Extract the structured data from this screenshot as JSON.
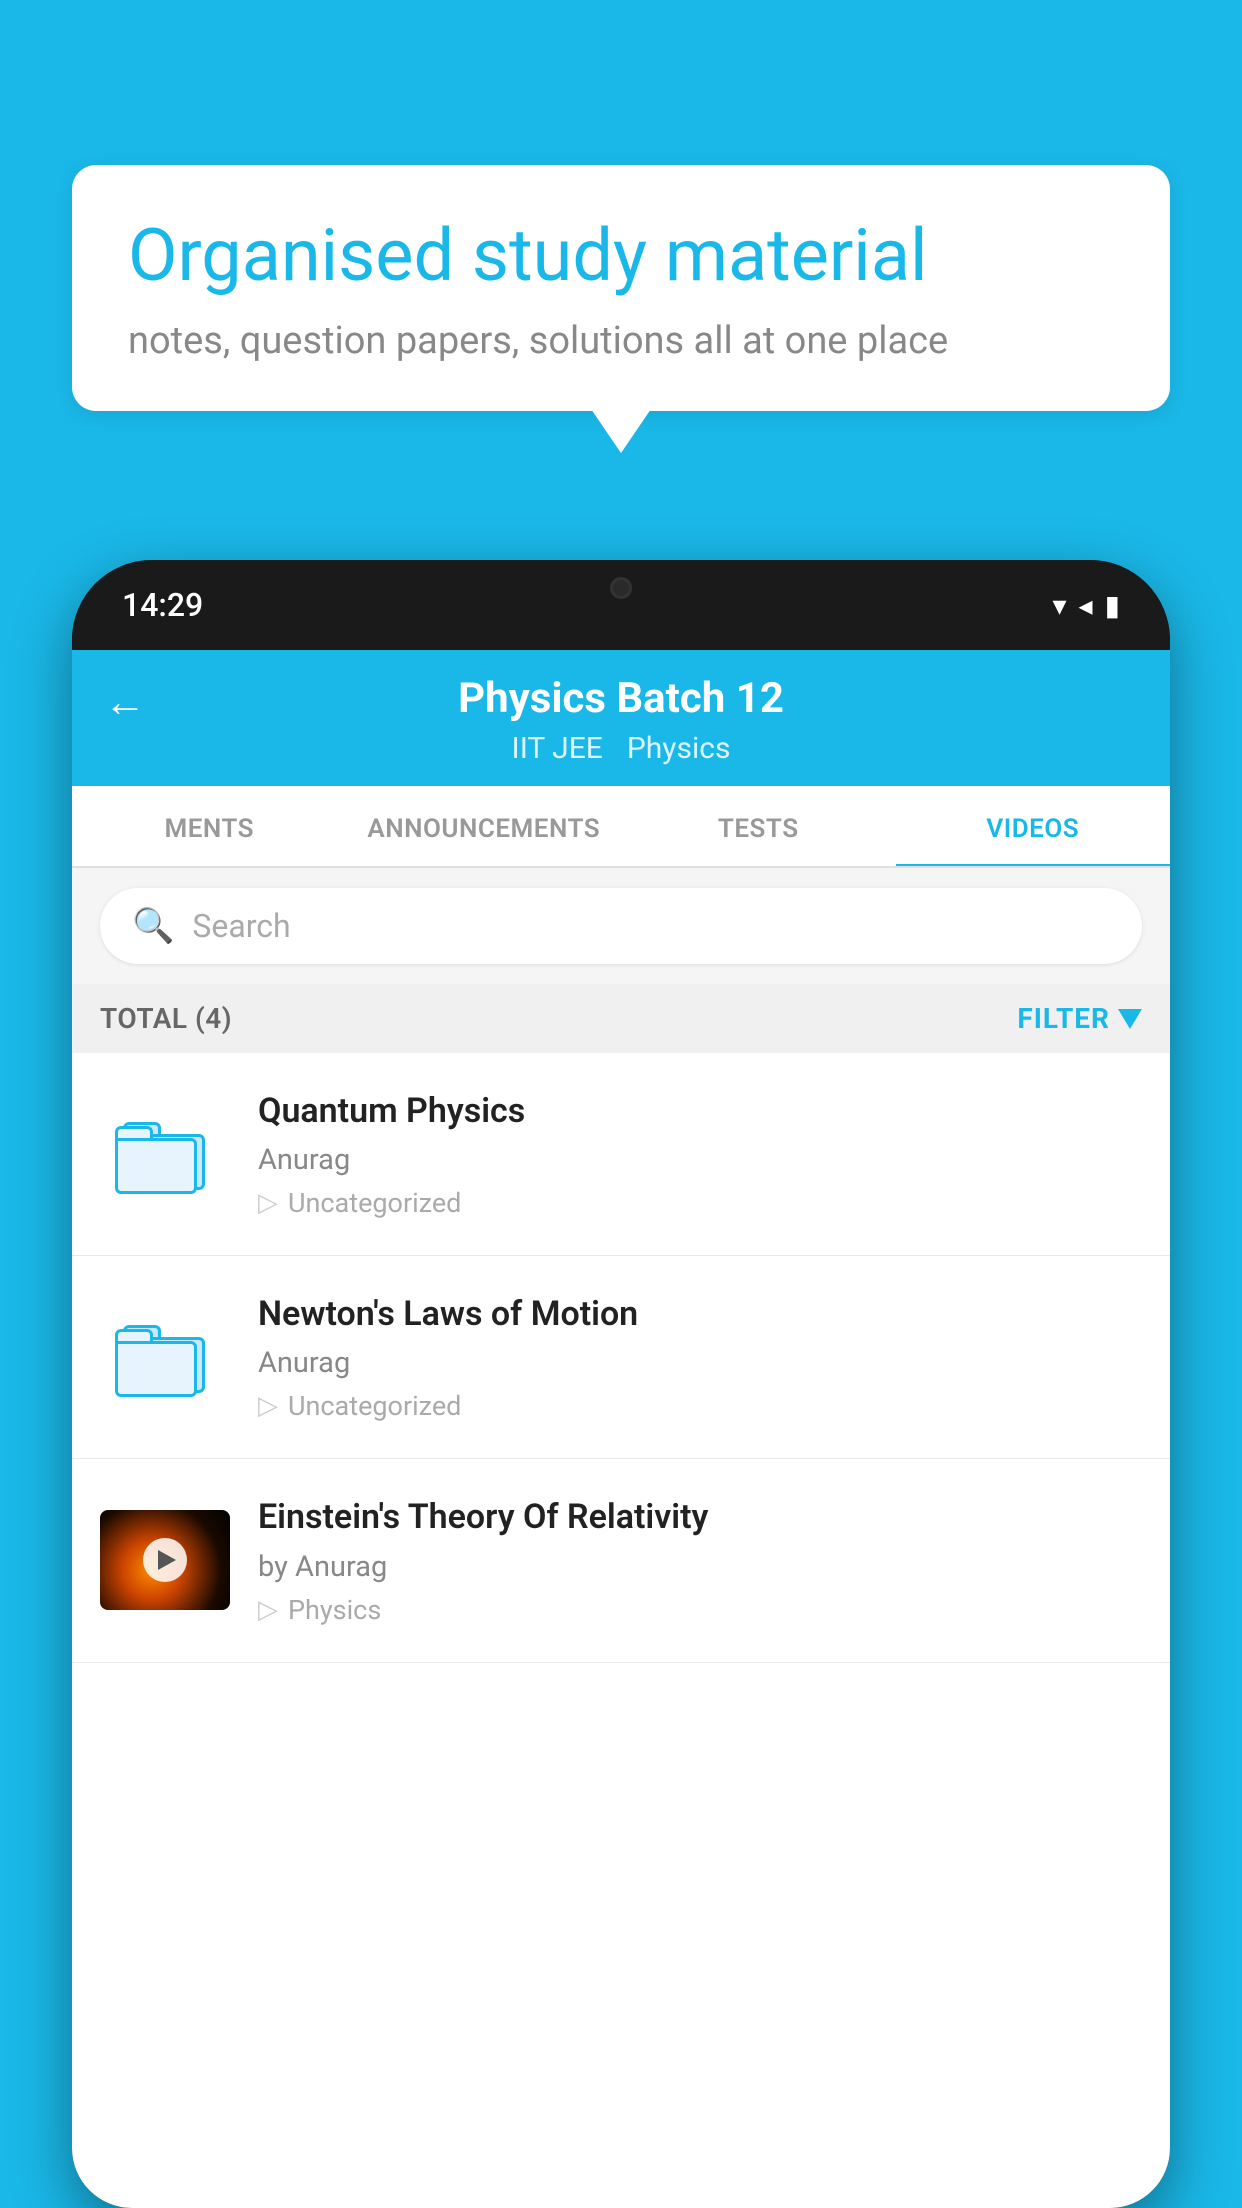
{
  "background": {
    "color": "#1ab8e8"
  },
  "speech_bubble": {
    "title": "Organised study material",
    "subtitle": "notes, question papers, solutions all at one place"
  },
  "phone": {
    "status_bar": {
      "time": "14:29"
    },
    "app_header": {
      "back_label": "←",
      "title": "Physics Batch 12",
      "tag1": "IIT JEE",
      "tag2": "Physics"
    },
    "tabs": [
      {
        "label": "MENTS",
        "active": false
      },
      {
        "label": "ANNOUNCEMENTS",
        "active": false
      },
      {
        "label": "TESTS",
        "active": false
      },
      {
        "label": "VIDEOS",
        "active": true
      }
    ],
    "search": {
      "placeholder": "Search"
    },
    "filter_bar": {
      "total_label": "TOTAL (4)",
      "filter_label": "FILTER"
    },
    "videos": [
      {
        "id": "1",
        "title": "Quantum Physics",
        "author": "Anurag",
        "category": "Uncategorized",
        "has_thumbnail": false
      },
      {
        "id": "2",
        "title": "Newton's Laws of Motion",
        "author": "Anurag",
        "category": "Uncategorized",
        "has_thumbnail": false
      },
      {
        "id": "3",
        "title": "Einstein's Theory Of Relativity",
        "author": "by Anurag",
        "category": "Physics",
        "has_thumbnail": true
      }
    ]
  }
}
